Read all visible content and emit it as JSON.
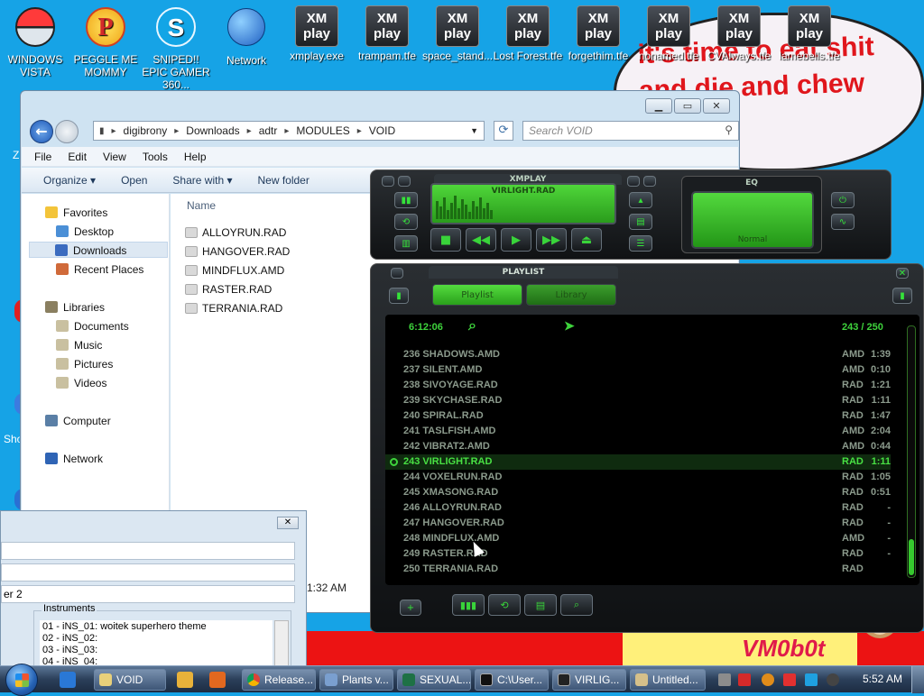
{
  "desktop": {
    "icons": [
      {
        "label": "WINDOWS VISTA"
      },
      {
        "label": "PEGGLE ME MOMMY"
      },
      {
        "label": "SNIPED!! EPIC GAMER 360..."
      },
      {
        "label": "Network"
      },
      {
        "label": "xmplay.exe",
        "badge": "XM play"
      },
      {
        "label": "trampam.tfe",
        "badge": "XM play"
      },
      {
        "label": "space_stand...",
        "badge": "XM play"
      },
      {
        "label": "Lost Forest.tfe",
        "badge": "XM play"
      },
      {
        "label": "forgethim.tfe",
        "badge": "XM play"
      },
      {
        "label": "nonamed.tfe",
        "badge": "XM play"
      },
      {
        "label": "CVAlways.tfe",
        "badge": "XM play"
      },
      {
        "label": "lamebells.tfe",
        "badge": "XM play"
      }
    ],
    "wallpaper_text": "it's time to eat shit and die and chew gum",
    "wallpaper_signature": "VM0b0t",
    "side_fragments": [
      "Z",
      "Sho"
    ]
  },
  "explorer": {
    "title": "VOID",
    "breadcrumb": [
      "digibrony",
      "Downloads",
      "adtr",
      "MODULES",
      "VOID"
    ],
    "search_placeholder": "Search VOID",
    "menu": [
      "File",
      "Edit",
      "View",
      "Tools",
      "Help"
    ],
    "toolbar": [
      "Organize ▾",
      "Open",
      "Share with ▾",
      "New folder"
    ],
    "nav": {
      "favorites": [
        "Favorites",
        "Desktop",
        "Downloads",
        "Recent Places"
      ],
      "libraries": [
        "Libraries",
        "Documents",
        "Music",
        "Pictures",
        "Videos"
      ],
      "computer": "Computer",
      "network": "Network"
    },
    "column_name": "Name",
    "files": [
      "ALLOYRUN.RAD",
      "HANGOVER.RAD",
      "MINDFLUX.AMD",
      "RASTER.RAD",
      "TERRANIA.RAD"
    ],
    "time_fragment": "1:32 AM"
  },
  "dialog": {
    "fragment_label": "er 2",
    "instruments_title": "Instruments",
    "instruments": [
      "01 - iNS_01: woitek superhero theme",
      "02 - iNS_02:",
      "03 - iNS_03:",
      "04 - iNS_04:"
    ]
  },
  "xmplay": {
    "title": "XMPLAY",
    "track": "VIRLIGHT.RAD",
    "eq_title": "EQ",
    "eq_preset": "Normal",
    "playlist_title": "PLAYLIST",
    "tabs": [
      "Playlist",
      "Library"
    ],
    "total_time": "6:12:06",
    "position": "243 / 250",
    "rows": [
      {
        "num": "236",
        "name": "SHADOWS.AMD",
        "type": "AMD",
        "dur": "1:39"
      },
      {
        "num": "237",
        "name": "SILENT.AMD",
        "type": "AMD",
        "dur": "0:10"
      },
      {
        "num": "238",
        "name": "SIVOYAGE.RAD",
        "type": "RAD",
        "dur": "1:21"
      },
      {
        "num": "239",
        "name": "SKYCHASE.RAD",
        "type": "RAD",
        "dur": "1:11"
      },
      {
        "num": "240",
        "name": "SPIRAL.RAD",
        "type": "RAD",
        "dur": "1:47"
      },
      {
        "num": "241",
        "name": "TASLFISH.AMD",
        "type": "AMD",
        "dur": "2:04"
      },
      {
        "num": "242",
        "name": "VIBRAT2.AMD",
        "type": "AMD",
        "dur": "0:44"
      },
      {
        "num": "243",
        "name": "VIRLIGHT.RAD",
        "type": "RAD",
        "dur": "1:11",
        "current": true
      },
      {
        "num": "244",
        "name": "VOXELRUN.RAD",
        "type": "RAD",
        "dur": "1:05"
      },
      {
        "num": "245",
        "name": "XMASONG.RAD",
        "type": "RAD",
        "dur": "0:51"
      },
      {
        "num": "246",
        "name": "ALLOYRUN.RAD",
        "type": "RAD",
        "dur": "-"
      },
      {
        "num": "247",
        "name": "HANGOVER.RAD",
        "type": "RAD",
        "dur": "-"
      },
      {
        "num": "248",
        "name": "MINDFLUX.AMD",
        "type": "AMD",
        "dur": "-"
      },
      {
        "num": "249",
        "name": "RASTER.RAD",
        "type": "RAD",
        "dur": "-"
      },
      {
        "num": "250",
        "name": "TERRANIA.RAD",
        "type": "RAD",
        "dur": ""
      }
    ]
  },
  "taskbar": {
    "buttons": [
      "VOID",
      "Release...",
      "Plants v...",
      "SEXUAL...",
      "C:\\User...",
      "VIRLIG...",
      "Untitled..."
    ],
    "clock": "5:52 AM"
  },
  "colors": {
    "accent": "#3ed33c",
    "desktop": "#16a3e6",
    "wallpaper_text": "#e0161c"
  }
}
